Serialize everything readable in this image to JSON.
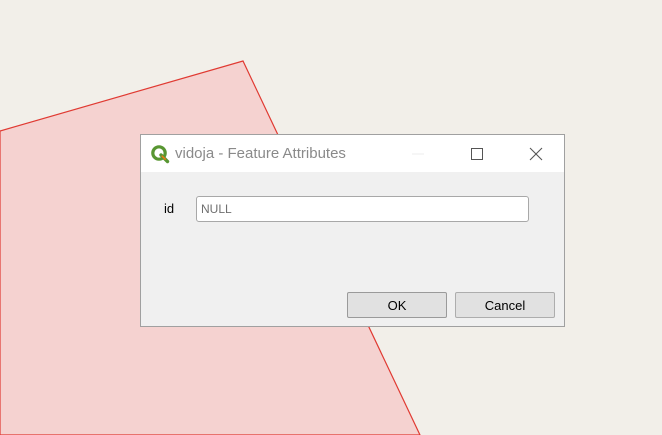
{
  "window": {
    "title": "vidoja - Feature Attributes",
    "app_icon": "qgis-logo-icon",
    "controls": [
      "minimize-icon",
      "maximize-icon",
      "close-icon"
    ]
  },
  "form": {
    "fields": [
      {
        "label": "id",
        "value": "NULL"
      }
    ]
  },
  "buttons": {
    "ok_label": "OK",
    "cancel_label": "Cancel"
  },
  "colors": {
    "map_background": "#f2efe9",
    "polygon_fill": "#f5d2d0",
    "polygon_stroke": "#e03a32",
    "qgis_green": "#589632",
    "qgis_yellow": "#ee7913"
  }
}
